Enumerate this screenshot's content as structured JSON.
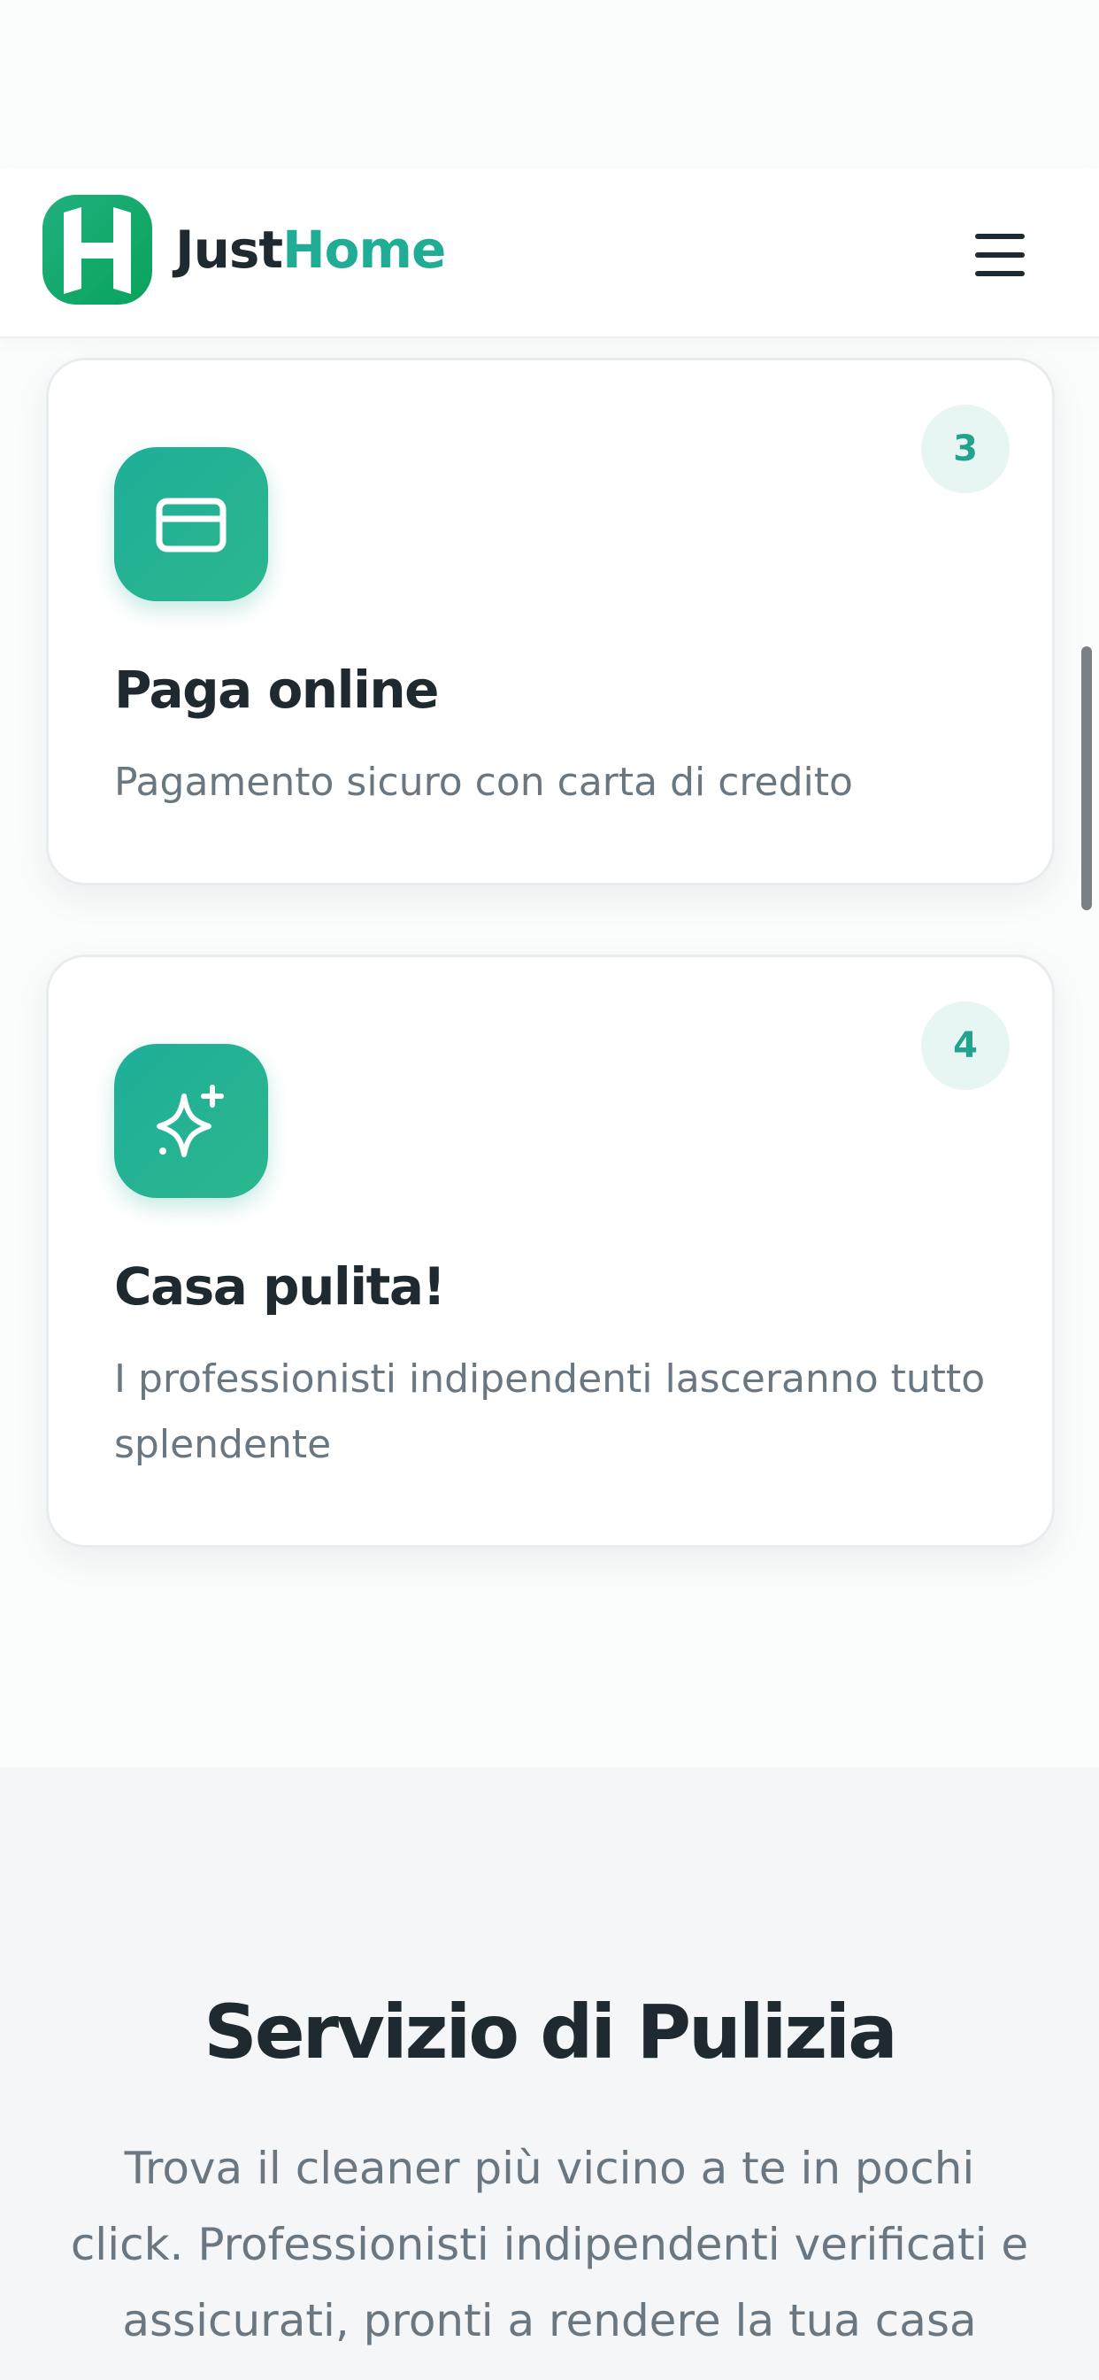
{
  "header": {
    "brand_part1": "Just",
    "brand_part2": "Home",
    "menu_icon": "hamburger-menu-icon",
    "colors": {
      "brand": "#21ad95",
      "logo_green": "#0fa86a",
      "text_dark": "#1f2a30"
    }
  },
  "steps": [
    {
      "number": "3",
      "icon": "credit-card-icon",
      "title": "Paga online",
      "description": "Pagamento sicuro con carta di credito"
    },
    {
      "number": "4",
      "icon": "sparkles-icon",
      "title": "Casa pulita!",
      "description": "I professionisti indipendenti lasceranno tutto splendente"
    }
  ],
  "section": {
    "title": "Servizio di Pulizia",
    "description": "Trova il cleaner più vicino a te in pochi click. Professionisti indipendenti verificati e assicurati, pronti a rendere la tua casa"
  }
}
